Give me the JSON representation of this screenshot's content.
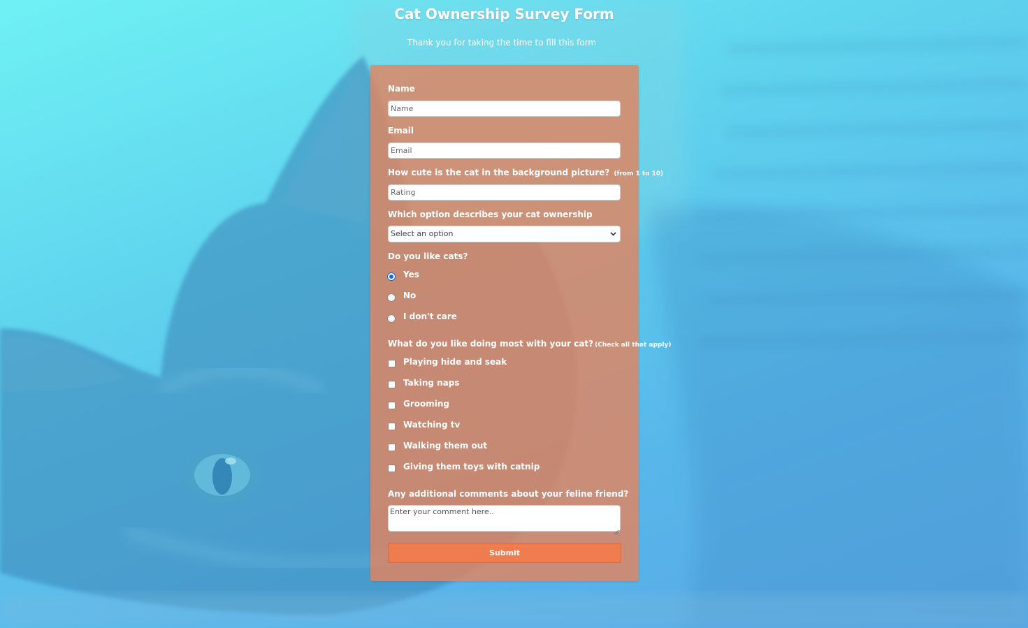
{
  "page": {
    "title": "Cat Ownership Survey Form",
    "subtitle": "Thank you for taking the time to fill this form"
  },
  "form": {
    "name": {
      "label": "Name",
      "placeholder": "Name",
      "value": ""
    },
    "email": {
      "label": "Email",
      "placeholder": "Email",
      "value": ""
    },
    "rating": {
      "label": "How cute is the cat in the background picture?",
      "hint": "(from 1 to 10)",
      "placeholder": "Rating",
      "value": ""
    },
    "ownership": {
      "label": "Which option describes your cat ownership",
      "selected": "Select an option"
    },
    "like_cats": {
      "label": "Do you like cats?",
      "options": [
        "Yes",
        "No",
        "I don't care"
      ],
      "selected": "Yes"
    },
    "activities": {
      "label": "What do you like doing most with your cat?",
      "hint": "(Check all that apply)",
      "options": [
        "Playing hide and seak",
        "Taking naps",
        "Grooming",
        "Watching tv",
        "Walking them out",
        "Giving them toys with catnip"
      ],
      "checked": []
    },
    "comments": {
      "label": "Any additional comments about your feline friend?",
      "placeholder": "Enter your comment here..",
      "value": ""
    },
    "submit_label": "Submit"
  },
  "icons": {
    "select_arrow": "chevron-down-icon",
    "textarea_resize": "resize-grip-icon"
  },
  "colors": {
    "background_gradient_start": "#6ff1f4",
    "background_gradient_end": "#5aa8e6",
    "form_panel": "#e2845f",
    "submit_button": "#ee7c4e",
    "radio_selected": "#1a66d2",
    "text_on_panel": "#ffffff"
  }
}
